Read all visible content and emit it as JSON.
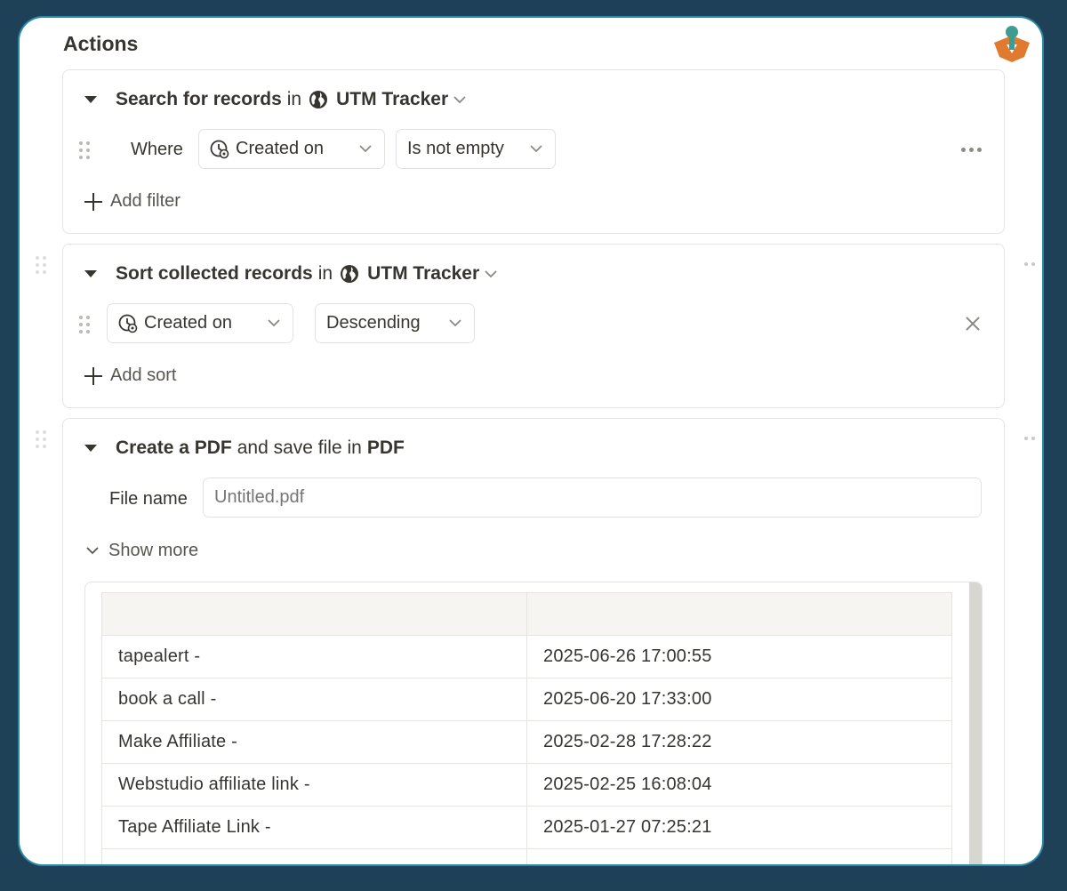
{
  "section_title": "Actions",
  "search_card": {
    "action": "Search for records",
    "preposition": "in",
    "database": "UTM Tracker",
    "where_label": "Where",
    "filter_property": "Created on",
    "filter_condition": "Is not empty",
    "add_filter_label": "Add filter"
  },
  "sort_card": {
    "action": "Sort collected records",
    "preposition": "in",
    "database": "UTM Tracker",
    "sort_property": "Created on",
    "sort_direction": "Descending",
    "add_sort_label": "Add sort"
  },
  "pdf_card": {
    "action_bold_1": "Create a PDF",
    "action_mid": "and save file in",
    "action_bold_2": "PDF",
    "file_name_label": "File name",
    "file_name_placeholder": "Untitled.pdf",
    "show_more_label": "Show more"
  },
  "preview_table": {
    "headers": [
      "",
      ""
    ],
    "rows": [
      [
        "tapealert -",
        "2025-06-26 17:00:55"
      ],
      [
        "book a call -",
        "2025-06-20 17:33:00"
      ],
      [
        "Make Affiliate -",
        "2025-02-28 17:28:22"
      ],
      [
        "Webstudio affiliate link -",
        "2025-02-25 16:08:04"
      ],
      [
        "Tape Affiliate Link -",
        "2025-01-27 07:25:21"
      ]
    ]
  },
  "icons": {
    "globe": "globe-icon",
    "clock": "clock-icon",
    "drag": "drag-handle-icon",
    "more": "more-icon",
    "close": "close-icon",
    "logo": "app-logo"
  },
  "colors": {
    "background": "#1f4157",
    "panel": "#ffffff",
    "text": "#37352f",
    "border": "#e5e4e0",
    "logo_orange": "#e07a2e",
    "logo_teal": "#3f9c92"
  }
}
